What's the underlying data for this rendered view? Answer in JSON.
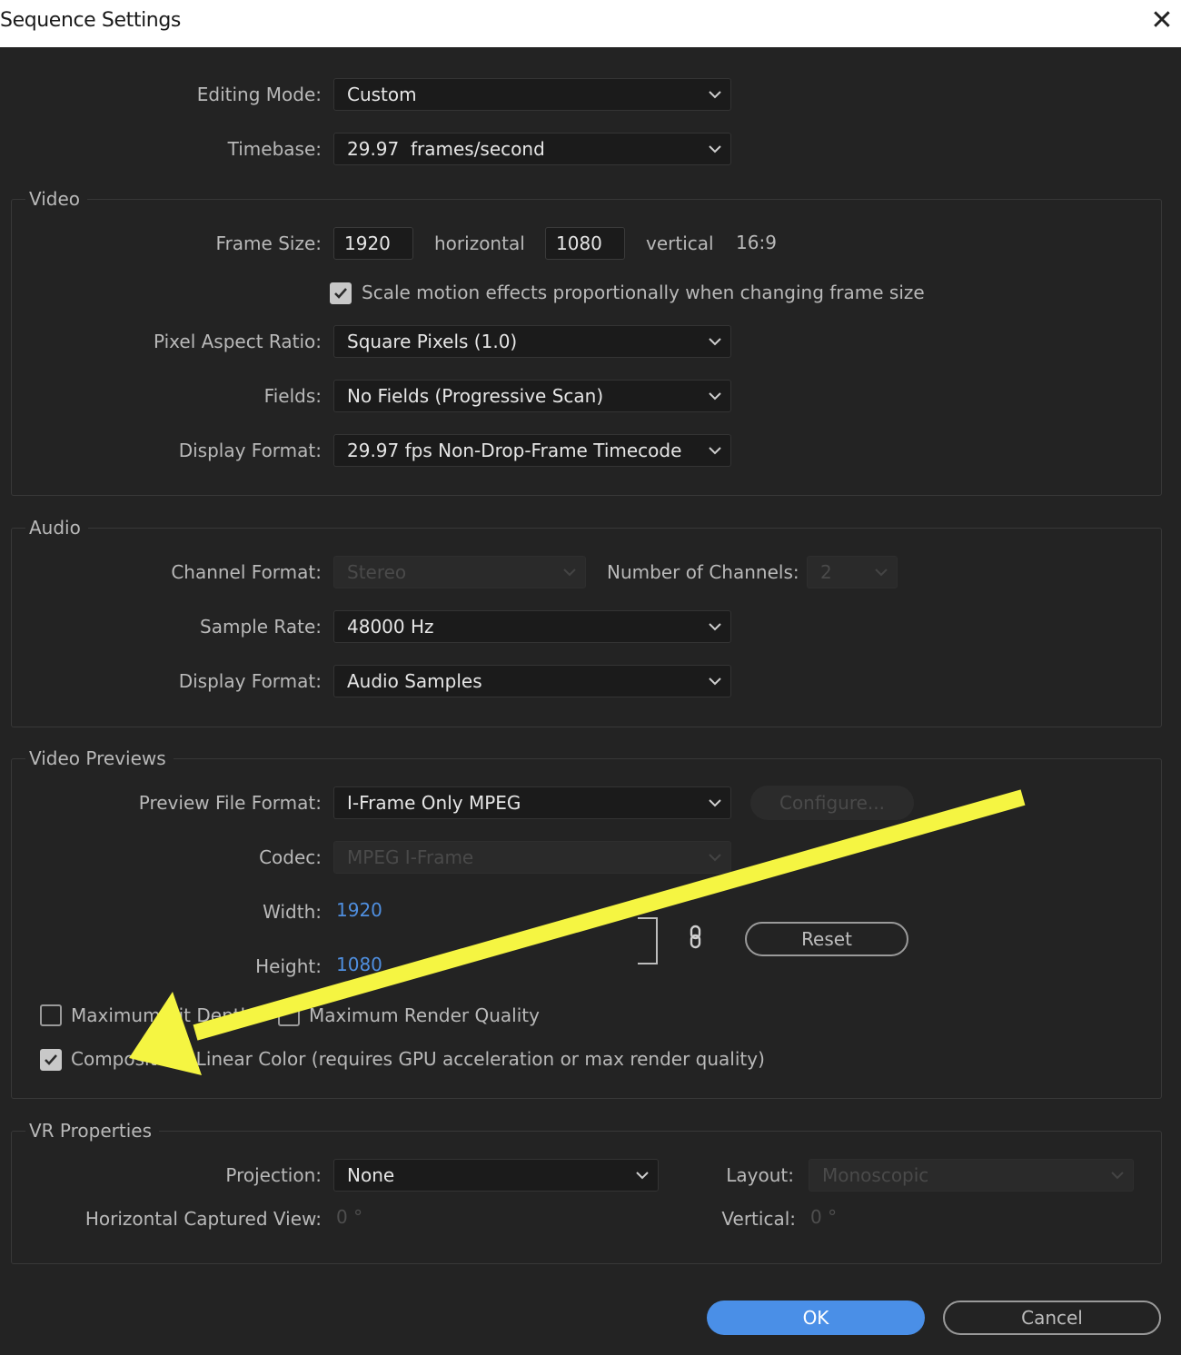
{
  "window": {
    "title": "Sequence Settings",
    "close_icon": "close-icon"
  },
  "general": {
    "editing_mode_label": "Editing Mode:",
    "editing_mode_value": "Custom",
    "timebase_label": "Timebase:",
    "timebase_value": "29.97  frames/second"
  },
  "video": {
    "group_label": "Video",
    "frame_size_label": "Frame Size:",
    "frame_width": "1920",
    "horizontal_label": "horizontal",
    "frame_height": "1080",
    "vertical_label": "vertical",
    "aspect": "16:9",
    "scale_motion_label": "Scale motion effects proportionally when changing frame size",
    "scale_motion_checked": true,
    "pixel_aspect_label": "Pixel Aspect Ratio:",
    "pixel_aspect_value": "Square Pixels (1.0)",
    "fields_label": "Fields:",
    "fields_value": "No Fields (Progressive Scan)",
    "display_format_label": "Display Format:",
    "display_format_value": "29.97 fps Non-Drop-Frame Timecode"
  },
  "audio": {
    "group_label": "Audio",
    "channel_format_label": "Channel Format:",
    "channel_format_value": "Stereo",
    "num_channels_label": "Number of Channels:",
    "num_channels_value": "2",
    "sample_rate_label": "Sample Rate:",
    "sample_rate_value": "48000 Hz",
    "display_format_label": "Display Format:",
    "display_format_value": "Audio Samples"
  },
  "previews": {
    "group_label": "Video Previews",
    "file_format_label": "Preview File Format:",
    "file_format_value": "I-Frame Only MPEG",
    "configure_label": "Configure...",
    "codec_label": "Codec:",
    "codec_value": "MPEG I-Frame",
    "width_label": "Width:",
    "width_value": "1920",
    "height_label": "Height:",
    "height_value": "1080",
    "reset_label": "Reset",
    "max_bit_depth_label": "Maximum Bit Depth",
    "max_render_quality_label": "Maximum Render Quality",
    "linear_color_label": "Composite in Linear Color (requires GPU acceleration or max render quality)",
    "linear_color_checked": true
  },
  "vr": {
    "group_label": "VR Properties",
    "projection_label": "Projection:",
    "projection_value": "None",
    "layout_label": "Layout:",
    "layout_value": "Monoscopic",
    "h_captured_label": "Horizontal Captured View:",
    "h_captured_value": "0 °",
    "vertical_label": "Vertical:",
    "vertical_value": "0 °"
  },
  "footer": {
    "ok_label": "OK",
    "cancel_label": "Cancel"
  },
  "annotation": {
    "arrow_color": "#f5f542"
  },
  "colors": {
    "accent": "#4a8fe7",
    "link_value": "#4f8fe0",
    "background": "#232323"
  }
}
